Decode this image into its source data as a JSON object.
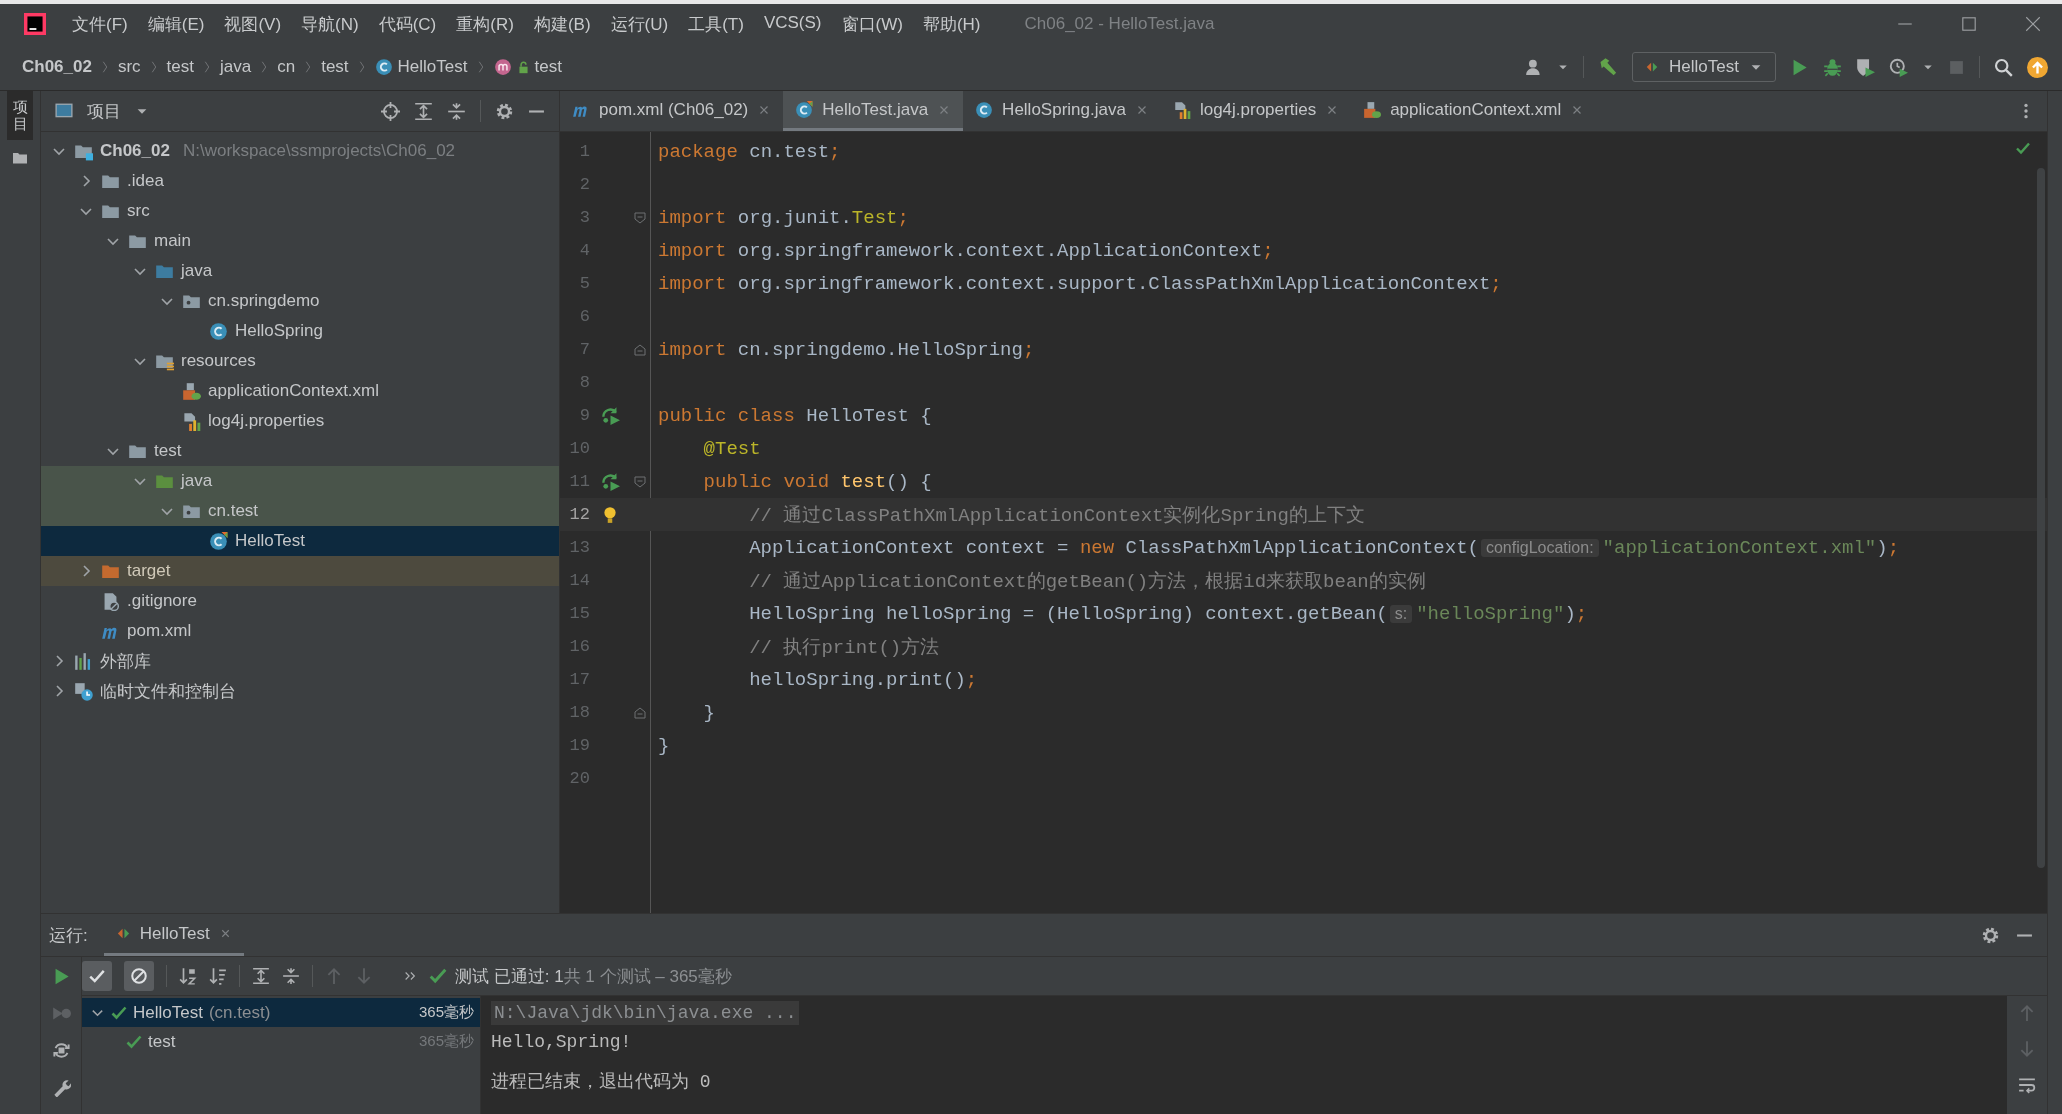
{
  "window": {
    "title": "Ch06_02 - HelloTest.java",
    "menu": [
      "文件(F)",
      "编辑(E)",
      "视图(V)",
      "导航(N)",
      "代码(C)",
      "重构(R)",
      "构建(B)",
      "运行(U)",
      "工具(T)",
      "VCS(S)",
      "窗口(W)",
      "帮助(H)"
    ]
  },
  "breadcrumbs": [
    {
      "label": "Ch06_02",
      "kind": "project"
    },
    {
      "label": "src",
      "kind": "folder"
    },
    {
      "label": "test",
      "kind": "folder"
    },
    {
      "label": "java",
      "kind": "folder"
    },
    {
      "label": "cn",
      "kind": "folder"
    },
    {
      "label": "test",
      "kind": "folder"
    },
    {
      "label": "HelloTest",
      "kind": "class"
    },
    {
      "label": "test",
      "kind": "method"
    }
  ],
  "run_config": {
    "label": "HelloTest"
  },
  "side_tab": {
    "label": "项目",
    "selected": true
  },
  "project": {
    "title": "项目",
    "tree": [
      {
        "label": "Ch06_02",
        "hint": "N:\\workspace\\ssmprojects\\Ch06_02",
        "kind": "module",
        "expanded": true,
        "selected": false,
        "children": [
          {
            "label": ".idea",
            "kind": "folder",
            "expanded": false,
            "selected": false
          },
          {
            "label": "src",
            "kind": "folder",
            "expanded": true,
            "selected": false,
            "children": [
              {
                "label": "main",
                "kind": "folder",
                "expanded": true,
                "selected": false,
                "children": [
                  {
                    "label": "java",
                    "kind": "source",
                    "expanded": true,
                    "selected": false,
                    "children": [
                      {
                        "label": "cn.springdemo",
                        "kind": "package",
                        "expanded": true,
                        "selected": false,
                        "children": [
                          {
                            "label": "HelloSpring",
                            "kind": "class",
                            "selected": false
                          }
                        ]
                      }
                    ]
                  },
                  {
                    "label": "resources",
                    "kind": "resources",
                    "expanded": true,
                    "selected": false,
                    "children": [
                      {
                        "label": "applicationContext.xml",
                        "kind": "xml",
                        "selected": false
                      },
                      {
                        "label": "log4j.properties",
                        "kind": "properties",
                        "selected": false
                      }
                    ]
                  }
                ]
              },
              {
                "label": "test",
                "kind": "folder",
                "expanded": true,
                "selected": false,
                "children": [
                  {
                    "label": "java",
                    "kind": "test-source",
                    "test_scope": true,
                    "expanded": true,
                    "selected": false,
                    "children": [
                      {
                        "label": "cn.test",
                        "kind": "package",
                        "test_scope": true,
                        "expanded": true,
                        "selected": false,
                        "children": [
                          {
                            "label": "HelloTest",
                            "kind": "test-class",
                            "selected": true
                          }
                        ]
                      }
                    ]
                  }
                ]
              }
            ]
          },
          {
            "label": "target",
            "kind": "excluded",
            "excluded": true,
            "expanded": false,
            "selected": false
          },
          {
            "label": ".gitignore",
            "kind": "gitignore",
            "selected": false
          },
          {
            "label": "pom.xml",
            "kind": "maven",
            "selected": false
          }
        ]
      },
      {
        "label": "外部库",
        "kind": "library",
        "expanded": false,
        "selected": false
      },
      {
        "label": "临时文件和控制台",
        "kind": "scratch",
        "expanded": false,
        "selected": false
      }
    ]
  },
  "editor": {
    "tabs": [
      {
        "label": "pom.xml (Ch06_02)",
        "kind": "maven",
        "selected": false
      },
      {
        "label": "HelloTest.java",
        "kind": "test-class",
        "selected": true
      },
      {
        "label": "HelloSpring.java",
        "kind": "class",
        "selected": false
      },
      {
        "label": "log4j.properties",
        "kind": "properties",
        "selected": false
      },
      {
        "label": "applicationContext.xml",
        "kind": "xml",
        "selected": false
      }
    ],
    "lines": [
      {
        "number": "1",
        "current": false,
        "segments": [
          {
            "kind": "keyword",
            "text": "package"
          },
          {
            "kind": "plain",
            "text": " cn.test"
          },
          {
            "kind": "keyword",
            "text": ";"
          }
        ]
      },
      {
        "number": "2",
        "current": false
      },
      {
        "number": "3",
        "current": false,
        "fold_start": true,
        "segments": [
          {
            "kind": "keyword",
            "text": "import"
          },
          {
            "kind": "plain",
            "text": " org.junit."
          },
          {
            "kind": "annotation",
            "text": "Test"
          },
          {
            "kind": "keyword",
            "text": ";"
          }
        ]
      },
      {
        "number": "4",
        "current": false,
        "segments": [
          {
            "kind": "keyword",
            "text": "import"
          },
          {
            "kind": "plain",
            "text": " org.springframework.context.ApplicationContext"
          },
          {
            "kind": "keyword",
            "text": ";"
          }
        ]
      },
      {
        "number": "5",
        "current": false,
        "segments": [
          {
            "kind": "keyword",
            "text": "import"
          },
          {
            "kind": "plain",
            "text": " org.springframework.context.support.ClassPathXmlApplicationContext"
          },
          {
            "kind": "keyword",
            "text": ";"
          }
        ]
      },
      {
        "number": "6",
        "current": false
      },
      {
        "number": "7",
        "current": false,
        "fold_end": true,
        "segments": [
          {
            "kind": "keyword",
            "text": "import"
          },
          {
            "kind": "plain",
            "text": " cn.springdemo.HelloSpring"
          },
          {
            "kind": "keyword",
            "text": ";"
          }
        ]
      },
      {
        "number": "8",
        "current": false
      },
      {
        "number": "9",
        "current": false,
        "run_marker": true,
        "segments": [
          {
            "kind": "keyword",
            "text": "public class"
          },
          {
            "kind": "plain",
            "text": " HelloTest {"
          }
        ]
      },
      {
        "number": "10",
        "current": false,
        "segments": [
          {
            "kind": "annotation",
            "text": "    @Test"
          }
        ]
      },
      {
        "number": "11",
        "current": false,
        "run_marker": true,
        "fold_start": true,
        "segments": [
          {
            "kind": "keyword",
            "text": "    public void"
          },
          {
            "kind": "function",
            "text": " test"
          },
          {
            "kind": "plain",
            "text": "() {"
          }
        ]
      },
      {
        "number": "12",
        "current": true,
        "bulb": true,
        "segments": [
          {
            "kind": "comment",
            "text": "        // 通过ClassPathXmlApplicationContext实例化Spring的上下文"
          }
        ]
      },
      {
        "number": "13",
        "current": false,
        "segments": [
          {
            "kind": "plain",
            "text": "        ApplicationContext context = "
          },
          {
            "kind": "keyword",
            "text": "new"
          },
          {
            "kind": "plain",
            "text": " ClassPathXmlApplicationContext("
          },
          {
            "kind": "hint",
            "text": "configLocation:"
          },
          {
            "kind": "string",
            "text": "\"applicationContext.xml\""
          },
          {
            "kind": "plain",
            "text": ")"
          },
          {
            "kind": "keyword",
            "text": ";"
          }
        ]
      },
      {
        "number": "14",
        "current": false,
        "segments": [
          {
            "kind": "comment",
            "text": "        // 通过ApplicationContext的getBean()方法，根据id来获取bean的实例"
          }
        ]
      },
      {
        "number": "15",
        "current": false,
        "segments": [
          {
            "kind": "plain",
            "text": "        HelloSpring helloSpring = (HelloSpring) context.getBean("
          },
          {
            "kind": "hint",
            "text": "s:"
          },
          {
            "kind": "string",
            "text": "\"helloSpring\""
          },
          {
            "kind": "plain",
            "text": ")"
          },
          {
            "kind": "keyword",
            "text": ";"
          }
        ]
      },
      {
        "number": "16",
        "current": false,
        "segments": [
          {
            "kind": "comment",
            "text": "        // 执行print()方法"
          }
        ]
      },
      {
        "number": "17",
        "current": false,
        "segments": [
          {
            "kind": "plain",
            "text": "        helloSpring.print()"
          },
          {
            "kind": "keyword",
            "text": ";"
          }
        ]
      },
      {
        "number": "18",
        "current": false,
        "fold_end": true,
        "segments": [
          {
            "kind": "plain",
            "text": "    }"
          }
        ]
      },
      {
        "number": "19",
        "current": false,
        "segments": [
          {
            "kind": "plain",
            "text": "}"
          }
        ]
      },
      {
        "number": "20",
        "current": false
      }
    ]
  },
  "run_panel": {
    "label": "运行:",
    "tab": "HelloTest",
    "status": {
      "text": "测试 已通过: 1",
      "detail": "共 1 个测试 – 365毫秒"
    },
    "tests": [
      {
        "label": "HelloTest",
        "package": "(cn.test)",
        "time": "365毫秒",
        "selected": true,
        "expanded": true,
        "children": [
          {
            "label": "test",
            "time": "365毫秒",
            "selected": false
          }
        ]
      }
    ],
    "console": [
      {
        "kind": "command",
        "text": "N:\\Java\\jdk\\bin\\java.exe ..."
      },
      {
        "kind": "output",
        "text": "Hello,Spring!"
      },
      {
        "kind": "exit",
        "text": "进程已结束，退出代码为 0"
      }
    ]
  }
}
